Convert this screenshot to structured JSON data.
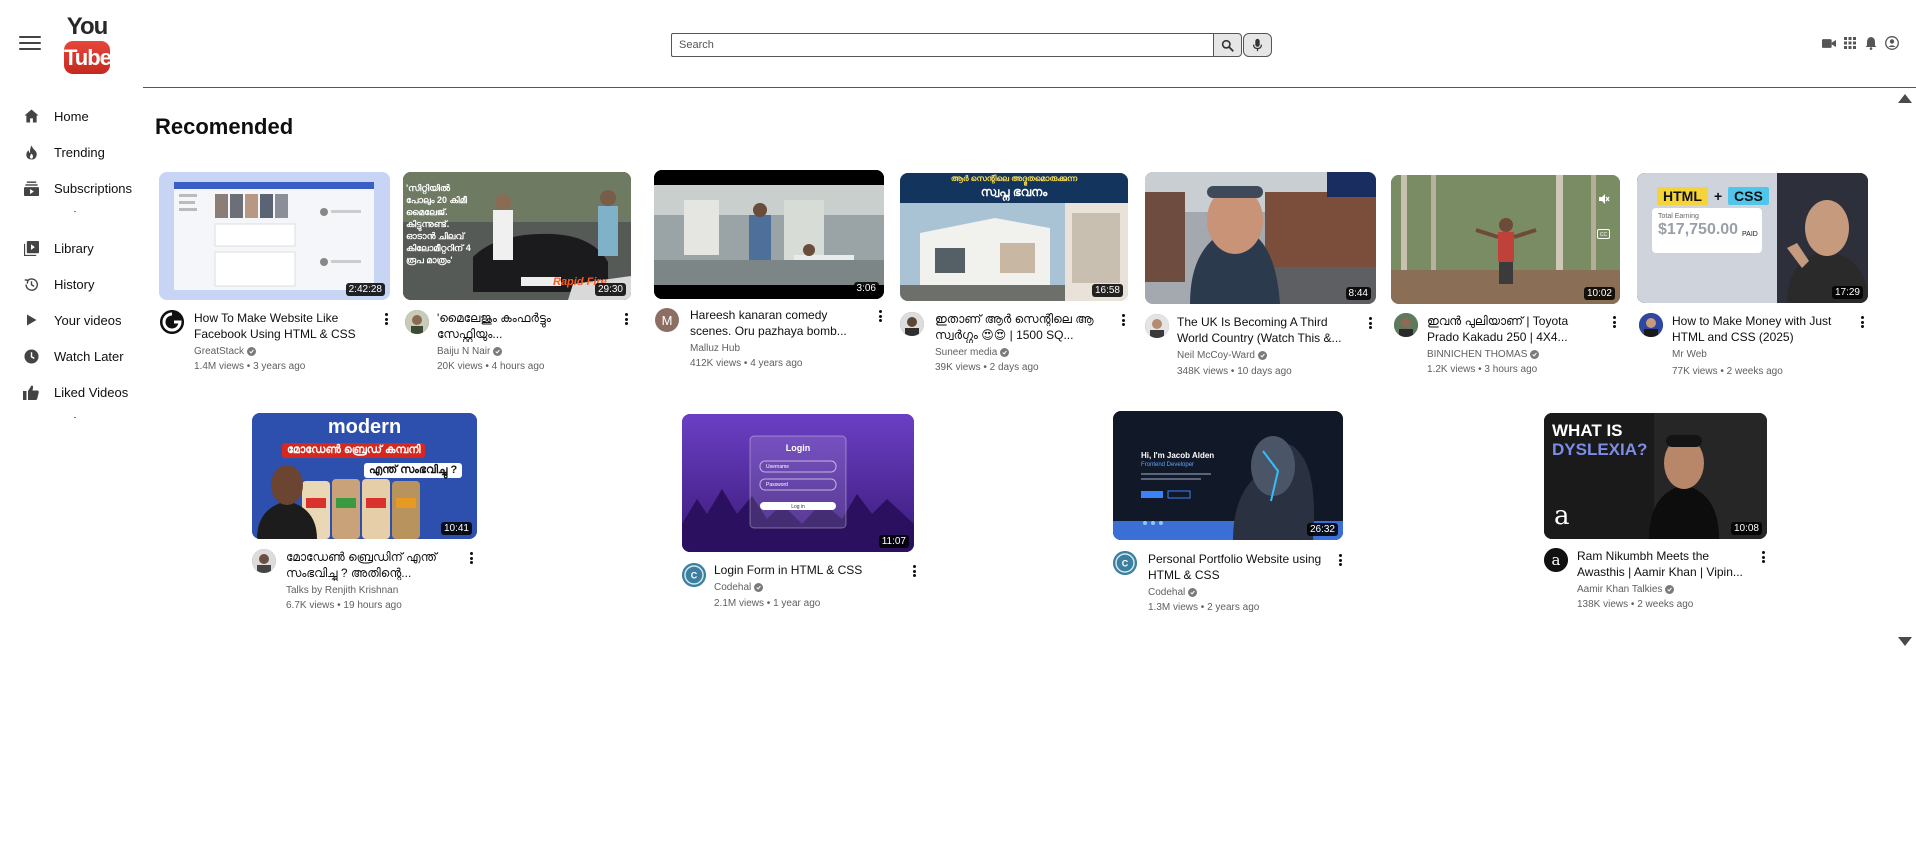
{
  "header": {
    "logo_top": "You",
    "logo_bottom": "Tube",
    "search_placeholder": "Search",
    "icons": [
      "menu-icon",
      "search-icon",
      "mic-icon",
      "video-camera-icon",
      "apps-grid-icon",
      "bell-icon",
      "account-icon"
    ]
  },
  "sidebar": {
    "items": [
      {
        "label": "Home",
        "icon": "home-icon"
      },
      {
        "label": "Trending",
        "icon": "fire-icon"
      },
      {
        "label": "Subscriptions",
        "icon": "subscriptions-icon"
      },
      {
        "label": "Library",
        "icon": "library-icon"
      },
      {
        "label": "History",
        "icon": "history-icon"
      },
      {
        "label": "Your videos",
        "icon": "play-icon"
      },
      {
        "label": "Watch Later",
        "icon": "clock-icon"
      },
      {
        "label": "Liked Videos",
        "icon": "thumbs-up-icon"
      }
    ]
  },
  "main": {
    "heading": "Recomended",
    "videos": [
      {
        "title": "How To Make Website Like Facebook Using HTML & CSS |...",
        "channel": "GreatStack",
        "verified": true,
        "views": "1.4M views",
        "age": "3 years ago",
        "duration": "2:42:28"
      },
      {
        "title": "'മൈലേജും കംഫർട്ടും സേഫ്റ്റിയും...",
        "channel": "Baiju N Nair",
        "verified": true,
        "views": "20K views",
        "age": "4 hours ago",
        "duration": "29:30"
      },
      {
        "title": "Hareesh kanaran comedy scenes. Oru pazhaya bomb...",
        "channel": "Malluz Hub",
        "verified": false,
        "views": "412K views",
        "age": "4 years ago",
        "duration": "3:06"
      },
      {
        "title": "ഇതാണ് ആർ സെന്റിലെ ആ സ്വർഗ്ഗം 😍😍 | 1500 SQ...",
        "channel": "Suneer media",
        "verified": true,
        "views": "39K views",
        "age": "2 days ago",
        "duration": "16:58"
      },
      {
        "title": "The UK Is Becoming A Third World Country (Watch This &...",
        "channel": "Neil McCoy-Ward",
        "verified": true,
        "views": "348K views",
        "age": "10 days ago",
        "duration": "8:44"
      },
      {
        "title": "ഇവൻ പുലിയാണ് | Toyota Prado Kakadu 250 | 4X4...",
        "channel": "BINNICHEN THOMAS",
        "verified": true,
        "views": "1.2K views",
        "age": "3 hours ago",
        "duration": "10:02"
      },
      {
        "title": "How to Make Money with Just HTML and CSS (2025)",
        "channel": "Mr Web",
        "verified": false,
        "views": "77K views",
        "age": "2 weeks ago",
        "duration": "17:29"
      },
      {
        "title": "മോഡേൺ ബ്രെഡിന് എന്ത് സംഭവിച്ചു ? അതിന്റെ...",
        "channel": "Talks by Renjith Krishnan",
        "verified": false,
        "views": "6.7K views",
        "age": "19 hours ago",
        "duration": "10:41"
      },
      {
        "title": "Login Form in HTML & CSS",
        "channel": "Codehal",
        "verified": true,
        "views": "2.1M views",
        "age": "1 year ago",
        "duration": "11:07"
      },
      {
        "title": "Personal Portfolio Website using HTML & CSS",
        "channel": "Codehal",
        "verified": true,
        "views": "1.3M views",
        "age": "2 years ago",
        "duration": "26:32"
      },
      {
        "title": "Ram Nikumbh Meets the Awasthis | Aamir Khan | Vipin...",
        "channel": "Aamir Khan Talkies",
        "verified": true,
        "views": "138K views",
        "age": "2 weeks ago",
        "duration": "10:08"
      }
    ]
  },
  "thumb_text": {
    "v1_mal": "'സിറ്റിയിൽ പോലും 20 കിമീ മൈലേജ്. കിട്ടുന്നുണ്ട്. ഓടാൻ ചിലവ് കിലോമീറ്ററിന് 4 രൂപ മാത്രം'",
    "v1_brand": "Rapid Fire",
    "v3_top": "ആർ സെന്റിലെ അദ്ഭുതമൊരുക്കുന്ന",
    "v3_main": "സ്വപ്ന ഭവനം",
    "v6_tag1": "HTML",
    "v6_plus": "+",
    "v6_tag2": "CSS",
    "v6_earn_label": "Total Earning",
    "v6_amount": "$17,750.00",
    "v6_paid": "PAID",
    "v7_brand": "modern",
    "v7_line1": "മോഡേൺ ബ്രെഡ് കമ്പനി",
    "v7_line2": "എന്ത് സംഭവിച്ചു ?",
    "v8_title": "Login",
    "v8_user": "Username",
    "v8_pass": "Password",
    "v8_btn": "Log in",
    "v9_name": "Hi, I'm Jacob Alden",
    "v9_role": "Frontend Developer",
    "v10_line1": "WHAT IS",
    "v10_line2": "DYSLEXIA?",
    "v10_logo": "a"
  },
  "colors": {
    "logo_red": "#cc2a20",
    "text": "#0f0f0f",
    "meta": "#606060"
  }
}
